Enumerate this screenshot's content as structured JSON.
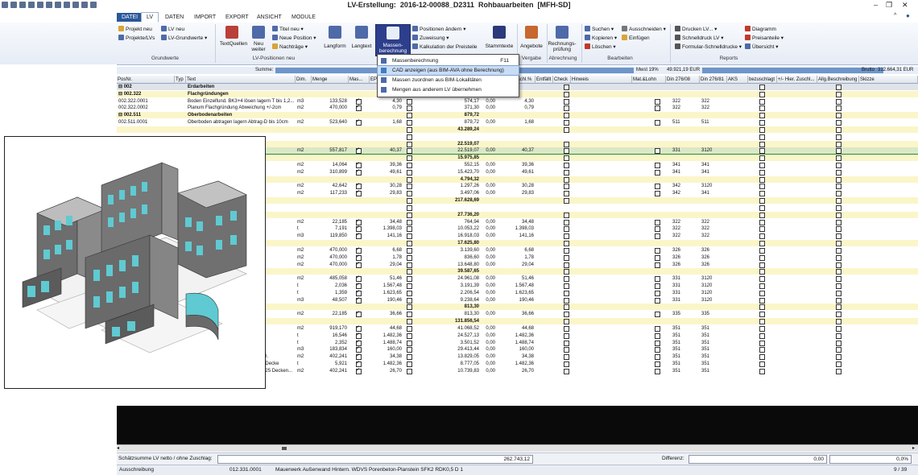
{
  "window": {
    "title_prefix": "LV-Erstellung:",
    "doc_id": "2016-12-00088_D2311",
    "doc_name": "Rohbauarbeiten",
    "project": "[MFH-SD]"
  },
  "tabs": [
    "DATEI",
    "LV",
    "DATEN",
    "IMPORT",
    "EXPORT",
    "ANSICHT",
    "MODULE"
  ],
  "ribbon": {
    "grundwerte": {
      "label": "Grundwerte",
      "items": [
        "Projekt neu",
        "Projekte/LVs",
        "LV neu",
        "LV-Grundwerte"
      ]
    },
    "lvpositionen": {
      "label": "LV-Positionen neu",
      "items": [
        "TextQuellen",
        "Neu weiter",
        "Titel neu",
        "Neue Position",
        "Nachträge",
        "Langform",
        "Langtext"
      ]
    },
    "massen": {
      "label": "Massen- berechnung",
      "items": [
        "Positionen ändern",
        "Zuweisung",
        "Kalkulation der Preisteile",
        "Stammtexte"
      ]
    },
    "vergabe": {
      "label": "Vergabe",
      "items": [
        "Angebote"
      ]
    },
    "abrechnung": {
      "label": "Abrechnung",
      "items": [
        "Rechnungs- prüfung"
      ]
    },
    "bearbeiten": {
      "label": "Bearbeiten",
      "items": [
        "Suchen",
        "Ausschneiden",
        "Kopieren",
        "Einfügen",
        "Löschen"
      ]
    },
    "reports": {
      "label": "Reports",
      "items": [
        "Drucken LV...",
        "Schnelldruck LV",
        "Formular-Schnelldrucke",
        "Diagramm",
        "Preisanteile",
        "Übersicht"
      ]
    }
  },
  "dropdown": [
    {
      "label": "Massenberechnung",
      "shortcut": "F11"
    },
    {
      "label": "CAD anzeigen (aus BIM-AVA ohne Berechnung)",
      "shortcut": ""
    },
    {
      "label": "Massen zuordnen aus BIM-Lokalitäten",
      "shortcut": ""
    },
    {
      "label": "Mengen aus anderem LV übernehmen",
      "shortcut": ""
    }
  ],
  "summebar": {
    "label": "Summe:",
    "mwst": "Mwst 19%",
    "mwst_val": "49.921,19 EUR",
    "brutto": "Brutto",
    "brutto_val": "312.664,31 EUR"
  },
  "columns": [
    "PosNr.",
    "Typ",
    "Text",
    "Dim.",
    "Menge",
    "Mas...",
    "EP",
    "",
    "Gesamtwert",
    "",
    "Nachl.%",
    "Entfällt",
    "Check",
    "Hinweis",
    "Mat.&Lohn",
    "Din 276/08",
    "Din 276/81",
    "AKS",
    "bezuschlagt",
    "+/- Hier. Zuschl...",
    "Allg.Beschreibung",
    "Skizze"
  ],
  "rows": [
    {
      "t": "g",
      "pos": "⊟ 002",
      "text": "Erdarbeiten",
      "bold": true
    },
    {
      "t": "y",
      "pos": "⊟ 002.322",
      "text": "Flachgründungen",
      "bold": true,
      "gesamt": "945,47"
    },
    {
      "t": "w",
      "pos": "002.322.0001",
      "text": "Boden Einzelfund. BK3+4 lösen lagern T bis 1,2...",
      "dim": "m3",
      "menge": "133,528",
      "ep": "4,30",
      "gesamt": "574,17",
      "n": "0,00",
      "ep2": "4,30",
      "d1": "322",
      "d2": "322"
    },
    {
      "t": "w",
      "pos": "002.322.0002",
      "text": "Planum Flachgründung Abweichung +/-2cm",
      "dim": "m2",
      "menge": "470,000",
      "ep": "0,79",
      "gesamt": "371,30",
      "n": "0,00",
      "ep2": "0,79",
      "d1": "322",
      "d2": "322"
    },
    {
      "t": "y",
      "pos": "⊟ 002.511",
      "text": "Oberbodenarbeiten",
      "bold": true,
      "gesamt": "879,72"
    },
    {
      "t": "w",
      "pos": "002.511.0001",
      "text": "Oberboden abtragen lagern Abtrag-D bis 10cm",
      "dim": "m2",
      "menge": "523,640",
      "ep": "1,68",
      "gesamt": "879,72",
      "n": "0,00",
      "ep2": "1,68",
      "d1": "511",
      "d2": "511"
    },
    {
      "t": "y",
      "pos": "",
      "text": "",
      "gesamt": "43.289,24"
    },
    {
      "t": "w",
      "pos": "",
      "text": ""
    },
    {
      "t": "y",
      "pos": "",
      "text": "",
      "gesamt": "22.519,07"
    },
    {
      "t": "sel",
      "pos": "",
      "text": "Porenb...",
      "dim": "m2",
      "menge": "557,817",
      "ep": "40,37",
      "gesamt": "22.519,07",
      "n": "0,00",
      "ep2": "40,37",
      "d1": "331",
      "d2": "3120"
    },
    {
      "t": "y",
      "pos": "",
      "text": "",
      "gesamt": "15.975,85"
    },
    {
      "t": "w",
      "pos": "",
      "text": "2 SFK12...",
      "dim": "m2",
      "menge": "14,064",
      "ep": "39,36",
      "gesamt": "552,15",
      "n": "0,00",
      "ep2": "39,36",
      "d1": "341",
      "d2": "341"
    },
    {
      "t": "w",
      "pos": "",
      "text": "SFK12 R...",
      "dim": "m2",
      "menge": "310,899",
      "ep": "49,61",
      "gesamt": "15.423,70",
      "n": "0,00",
      "ep2": "49,61",
      "d1": "341",
      "d2": "341"
    },
    {
      "t": "y",
      "pos": "",
      "text": "",
      "gesamt": "4.794,32"
    },
    {
      "t": "w",
      "pos": "",
      "text": "P SFK...",
      "dim": "m2",
      "menge": "42,642",
      "ep": "30,28",
      "gesamt": "1.297,26",
      "n": "0,00",
      "ep2": "30,28",
      "d1": "342",
      "d2": "3120"
    },
    {
      "t": "w",
      "pos": "",
      "text": "P SFK...",
      "dim": "m2",
      "menge": "117,233",
      "ep": "29,83",
      "gesamt": "3.497,06",
      "n": "0,00",
      "ep2": "29,83",
      "d1": "342",
      "d2": "341"
    },
    {
      "t": "y",
      "pos": "",
      "text": "",
      "gesamt": "217.628,69"
    },
    {
      "t": "w",
      "pos": "",
      "text": ""
    },
    {
      "t": "y",
      "pos": "",
      "text": "",
      "gesamt": "27.736,20"
    },
    {
      "t": "w",
      "pos": "",
      "text": "",
      "dim": "m2",
      "menge": "22,185",
      "ep": "34,48",
      "gesamt": "764,94",
      "n": "0,00",
      "ep2": "34,48",
      "d1": "322",
      "d2": "322"
    },
    {
      "t": "w",
      "pos": "",
      "text": "Einzelf...",
      "dim": "t",
      "menge": "7,191",
      "ep": "1.398,03",
      "gesamt": "10.053,22",
      "n": "0,00",
      "ep2": "1.398,03",
      "d1": "322",
      "d2": "322"
    },
    {
      "t": "w",
      "pos": "",
      "text": "D",
      "dim": "m3",
      "menge": "119,850",
      "ep": "141,16",
      "gesamt": "16.918,03",
      "n": "0,00",
      "ep2": "141,16",
      "d1": "322",
      "d2": "322"
    },
    {
      "t": "y",
      "pos": "",
      "text": "",
      "gesamt": "17.625,80"
    },
    {
      "t": "w",
      "pos": "",
      "text": "C25/3...",
      "dim": "m2",
      "menge": "470,000",
      "ep": "6,68",
      "gesamt": "3.139,60",
      "n": "0,00",
      "ep2": "6,68",
      "d1": "326",
      "d2": "326"
    },
    {
      "t": "w",
      "pos": "",
      "text": "",
      "dim": "m2",
      "menge": "470,000",
      "ep": "1,78",
      "gesamt": "836,60",
      "n": "0,00",
      "ep2": "1,78",
      "d1": "326",
      "d2": "326"
    },
    {
      "t": "w",
      "pos": "",
      "text": "0,035...",
      "dim": "m2",
      "menge": "470,000",
      "ep": "29,04",
      "gesamt": "13.648,80",
      "n": "0,00",
      "ep2": "29,04",
      "d1": "326",
      "d2": "326"
    },
    {
      "t": "y",
      "pos": "",
      "text": "",
      "gesamt": "39.587,65"
    },
    {
      "t": "w",
      "pos": "",
      "text": "",
      "dim": "m2",
      "menge": "485,058",
      "ep": "51,46",
      "gesamt": "24.961,08",
      "n": "0,00",
      "ep2": "51,46",
      "d1": "331",
      "d2": "3120"
    },
    {
      "t": "w",
      "pos": "",
      "text": "wand",
      "dim": "t",
      "menge": "2,036",
      "ep": "1.567,48",
      "gesamt": "3.191,39",
      "n": "0,00",
      "ep2": "1.567,48",
      "d1": "331",
      "d2": "3120"
    },
    {
      "t": "w",
      "pos": "",
      "text": "Außen...",
      "dim": "t",
      "menge": "1,359",
      "ep": "1.623,65",
      "gesamt": "2.206,54",
      "n": "0,00",
      "ep2": "1.623,65",
      "d1": "331",
      "d2": "3120"
    },
    {
      "t": "w",
      "pos": "",
      "text": "0 C82...",
      "dim": "m3",
      "menge": "48,507",
      "ep": "190,46",
      "gesamt": "9.238,64",
      "n": "0,00",
      "ep2": "190,46",
      "d1": "331",
      "d2": "3120"
    },
    {
      "t": "y",
      "pos": "",
      "text": "",
      "gesamt": "813,30"
    },
    {
      "t": "w",
      "pos": "",
      "text": "",
      "dim": "m2",
      "menge": "22,185",
      "ep": "36,66",
      "gesamt": "813,30",
      "n": "0,00",
      "ep2": "36,66",
      "d1": "335",
      "d2": "335"
    },
    {
      "t": "y",
      "pos": "",
      "text": "",
      "gesamt": "131.856,54"
    },
    {
      "t": "w",
      "pos": "",
      "text": "0,035...",
      "dim": "m2",
      "menge": "919,170",
      "ep": "44,68",
      "gesamt": "41.068,52",
      "n": "0,00",
      "ep2": "44,68",
      "d1": "351",
      "d2": "351"
    },
    {
      "t": "w",
      "pos": "",
      "text": "Deckenpl.",
      "dim": "t",
      "menge": "16,546",
      "ep": "1.482,36",
      "gesamt": "24.527,13",
      "n": "0,00",
      "ep2": "1.482,36",
      "d1": "351",
      "d2": "351"
    },
    {
      "t": "w",
      "pos": "",
      "text": "Decke...",
      "dim": "t",
      "menge": "2,352",
      "ep": "1.488,74",
      "gesamt": "3.501,52",
      "n": "0,00",
      "ep2": "1.488,74",
      "d1": "351",
      "d2": "351"
    },
    {
      "t": "w",
      "pos": "",
      "text": "0 18-2...",
      "dim": "m3",
      "menge": "183,834",
      "ep": "160,00",
      "gesamt": "29.413,44",
      "n": "0,00",
      "ep2": "160,00",
      "d1": "351",
      "d2": "351"
    },
    {
      "t": "w",
      "pos": "013.351.0005",
      "text": "Schalung Deckenpl. GP-Schalungspl.",
      "dim": "m2",
      "menge": "402,241",
      "ep": "34,38",
      "gesamt": "13.829,05",
      "n": "0,00",
      "ep2": "34,38",
      "d1": "351",
      "d2": "351"
    },
    {
      "t": "w",
      "pos": "013.351.0006",
      "text": "Betonstahlmatte B500A Lagermatte Decke",
      "dim": "t",
      "menge": "5,921",
      "ep": "1.482,36",
      "gesamt": "8.777,05",
      "n": "0,00",
      "ep2": "1.482,36",
      "d1": "351",
      "d2": "351"
    },
    {
      "t": "w",
      "pos": "013.351.0007",
      "text": "Ortbeton Deckenpl. Stahlbeton C20/25 Decken...",
      "dim": "m2",
      "menge": "402,241",
      "ep": "26,70",
      "gesamt": "10.739,83",
      "n": "0,00",
      "ep2": "26,70",
      "d1": "351",
      "d2": "351"
    }
  ],
  "footer": {
    "label": "Schätzsumme LV netto / ohne Zuschlag:",
    "value": "262.743,12",
    "diff_label": "Differenz:",
    "diff_val": "0,00",
    "diff_pct": "0,0%"
  },
  "status": {
    "mode": "Ausschreibung",
    "pos": "012.331.0001",
    "text": "Mauerwerk Außenwand Hintern. WDVS Porenbeton-Planstein SFK2 RDK0,5 D 1",
    "page": "9 / 39"
  }
}
